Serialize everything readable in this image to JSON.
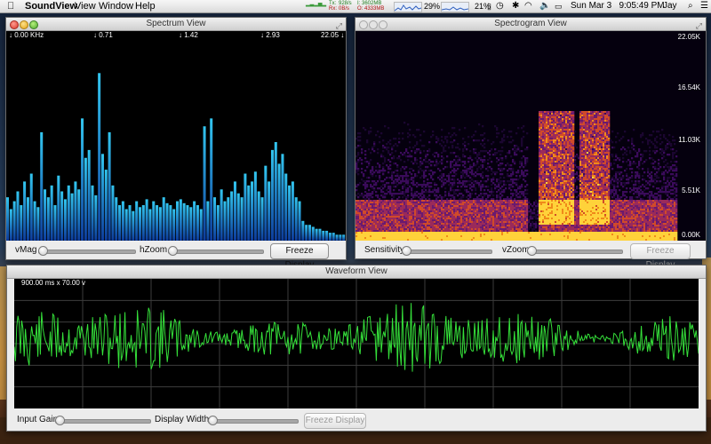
{
  "menubar": {
    "app_name": "SoundView",
    "menus": [
      "View",
      "Window",
      "Help"
    ],
    "net_tx_label": "Tx:",
    "net_rx_label": "Rx:",
    "net_tx_value": "928/s",
    "net_rx_value": "0B/s",
    "net_i_value": "I: 3602MB",
    "net_o_value": "O: 4333MB",
    "cpu_percent": "29%",
    "battery_percent": "21%",
    "datetime": "Sun Mar 3   9:05:49 PM",
    "user": "Jay"
  },
  "spectrum_window": {
    "title": "Spectrum View",
    "freq_labels": [
      "↓ 0.00 KHz",
      "↓ 0.71",
      "↓ 1.42",
      "↓ 2.93",
      "22.05 ↓"
    ],
    "vmag_label": "vMag",
    "hzoom_label": "hZoom",
    "vmag_level": 0.0,
    "hzoom_level": 0.0,
    "freeze_label": "Freeze Display",
    "bar_levels": [
      0.22,
      0.16,
      0.2,
      0.25,
      0.18,
      0.3,
      0.22,
      0.34,
      0.2,
      0.17,
      0.55,
      0.26,
      0.22,
      0.28,
      0.18,
      0.33,
      0.25,
      0.21,
      0.28,
      0.24,
      0.3,
      0.26,
      0.62,
      0.42,
      0.46,
      0.28,
      0.23,
      0.85,
      0.44,
      0.36,
      0.55,
      0.28,
      0.22,
      0.18,
      0.2,
      0.16,
      0.18,
      0.15,
      0.2,
      0.17,
      0.18,
      0.21,
      0.16,
      0.2,
      0.18,
      0.17,
      0.22,
      0.19,
      0.18,
      0.16,
      0.2,
      0.21,
      0.19,
      0.18,
      0.17,
      0.2,
      0.18,
      0.16,
      0.58,
      0.2,
      0.62,
      0.22,
      0.18,
      0.26,
      0.2,
      0.22,
      0.25,
      0.3,
      0.24,
      0.22,
      0.34,
      0.28,
      0.3,
      0.35,
      0.25,
      0.22,
      0.38,
      0.3,
      0.46,
      0.5,
      0.39,
      0.44,
      0.34,
      0.28,
      0.3,
      0.22,
      0.2,
      0.1,
      0.08,
      0.08,
      0.07,
      0.06,
      0.06,
      0.05,
      0.05,
      0.04,
      0.04,
      0.03,
      0.03,
      0.03
    ]
  },
  "spectrogram_window": {
    "title": "Spectrogram View",
    "y_labels": [
      "22.05K",
      "16.54K",
      "11.03K",
      "5.51K",
      "0.00K"
    ],
    "sensitivity_label": "Sensitivity",
    "vzoom_label": "vZoom",
    "sensitivity_level": 0.0,
    "vzoom_level": 0.0,
    "freeze_label": "Freeze Display"
  },
  "waveform_window": {
    "title": "Waveform View",
    "scale_caption": "900.00 ms x 70.00 v",
    "input_gain_label": "Input Gain",
    "display_width_label": "Display Width",
    "input_gain_level": 0.0,
    "display_width_level": 0.0,
    "freeze_label": "Freeze Display"
  },
  "colors": {
    "spectrum_bar_top": "#29b6e8",
    "spectrum_bar_bottom": "#1040a0",
    "waveform": "#35e03a",
    "grid": "#3d3d3d"
  }
}
